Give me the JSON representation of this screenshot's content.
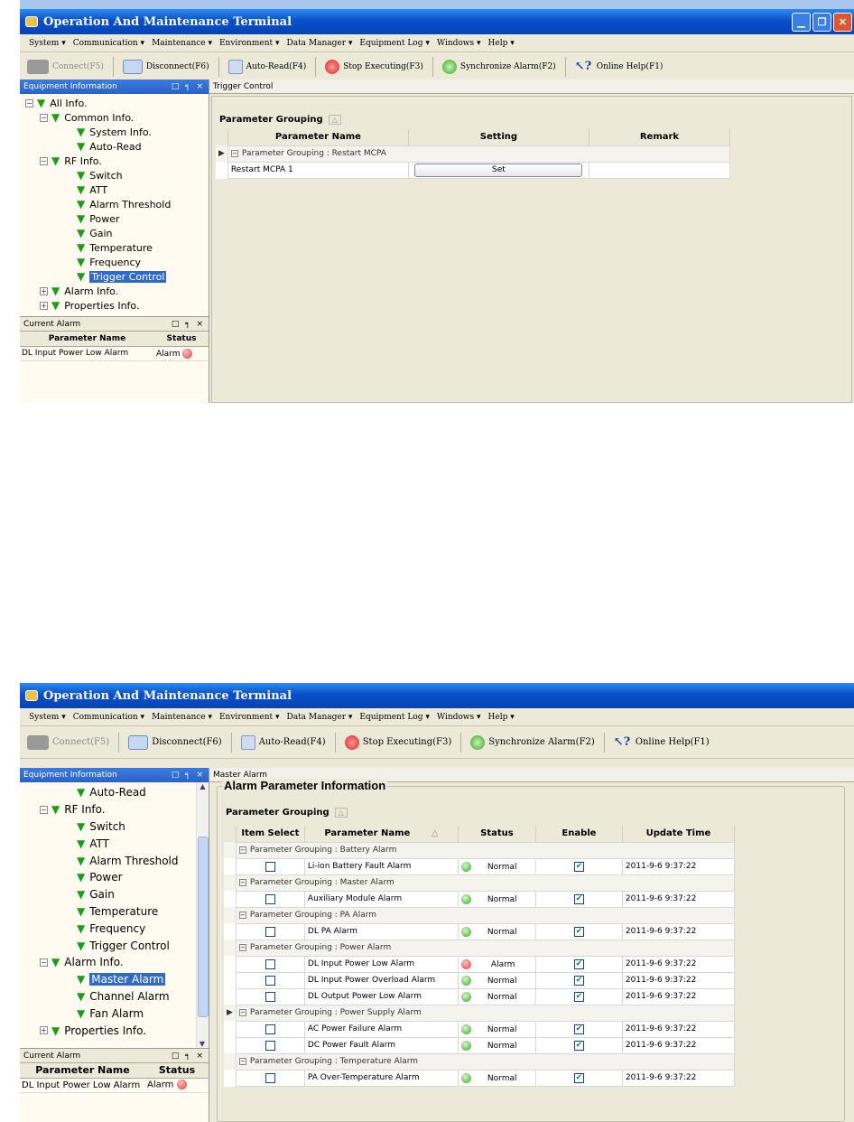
{
  "app_title": "Operation And Maintenance Terminal",
  "menu": [
    "System ▾",
    "Communication ▾",
    "Maintenance ▾",
    "Environment ▾",
    "Data Manager ▾",
    "Equipment Log ▾",
    "Windows ▾",
    "Help ▾"
  ],
  "toolbar": {
    "connect": "Connect(F5)",
    "disconnect": "Disconnect(F6)",
    "auto_read": "Auto-Read(F4)",
    "stop": "Stop Executing(F3)",
    "sync": "Synchronize Alarm(F2)",
    "help": "Online Help(F1)"
  },
  "panels": {
    "equipment": "Equipment Information",
    "current_alarm": "Current Alarm",
    "panel_controls": "□ ╕ ×"
  },
  "tree1": [
    {
      "label": "All Info.",
      "exp": "−"
    },
    {
      "label": "Common Info.",
      "exp": "−"
    },
    {
      "label": "System Info."
    },
    {
      "label": "Auto-Read"
    },
    {
      "label": "RF Info.",
      "exp": "−"
    },
    {
      "label": "Switch"
    },
    {
      "label": "ATT"
    },
    {
      "label": "Alarm Threshold"
    },
    {
      "label": "Power"
    },
    {
      "label": "Gain"
    },
    {
      "label": "Temperature"
    },
    {
      "label": "Frequency"
    },
    {
      "label": "Trigger Control"
    },
    {
      "label": "Alarm Info.",
      "exp": "+"
    },
    {
      "label": "Properties Info.",
      "exp": "+"
    }
  ],
  "tree2": [
    {
      "label": "Auto-Read"
    },
    {
      "label": "RF Info.",
      "exp": "−"
    },
    {
      "label": "Switch"
    },
    {
      "label": "ATT"
    },
    {
      "label": "Alarm Threshold"
    },
    {
      "label": "Power"
    },
    {
      "label": "Gain"
    },
    {
      "label": "Temperature"
    },
    {
      "label": "Frequency"
    },
    {
      "label": "Trigger Control"
    },
    {
      "label": "Alarm Info.",
      "exp": "−"
    },
    {
      "label": "Master Alarm"
    },
    {
      "label": "Channel Alarm"
    },
    {
      "label": "Fan Alarm"
    },
    {
      "label": "Properties Info.",
      "exp": "+"
    }
  ],
  "current_alarm": {
    "headers": {
      "name": "Parameter Name",
      "status": "Status"
    },
    "row": {
      "name": "DL Input Power Low Alarm",
      "status": "Alarm"
    }
  },
  "w1": {
    "tab": "Trigger Control",
    "group_label": "Parameter Grouping",
    "headers": {
      "name": "Parameter Name",
      "setting": "Setting",
      "remark": "Remark"
    },
    "group_row": "Parameter Grouping : Restart MCPA",
    "param": "Restart MCPA 1",
    "set": "Set"
  },
  "w2": {
    "tab": "Master Alarm",
    "fieldset": "Alarm Parameter Information",
    "group_label": "Parameter Grouping",
    "headers": {
      "select": "Item Select",
      "name": "Parameter Name",
      "status": "Status",
      "enable": "Enable",
      "time": "Update Time"
    },
    "groups": [
      {
        "title": "Parameter Grouping : Battery Alarm",
        "rows": [
          {
            "name": "Li-ion Battery Fault Alarm",
            "status": "Normal",
            "time": "2011-9-6 9:37:22"
          }
        ]
      },
      {
        "title": "Parameter Grouping : Master Alarm",
        "rows": [
          {
            "name": "Auxiliary Module Alarm",
            "status": "Normal",
            "time": "2011-9-6 9:37:22"
          }
        ]
      },
      {
        "title": "Parameter Grouping : PA Alarm",
        "rows": [
          {
            "name": "DL PA Alarm",
            "status": "Normal",
            "time": "2011-9-6 9:37:22"
          }
        ]
      },
      {
        "title": "Parameter Grouping : Power Alarm",
        "rows": [
          {
            "name": "DL Input Power Low Alarm",
            "status": "Alarm",
            "time": "2011-9-6 9:37:22"
          },
          {
            "name": "DL Input Power Overload Alarm",
            "status": "Normal",
            "time": "2011-9-6 9:37:22"
          },
          {
            "name": "DL Output Power Low Alarm",
            "status": "Normal",
            "time": "2011-9-6 9:37:22"
          }
        ]
      },
      {
        "title": "Parameter Grouping : Power Supply Alarm",
        "rows": [
          {
            "name": "AC Power Failure Alarm",
            "status": "Normal",
            "time": "2011-9-6 9:37:22"
          },
          {
            "name": "DC Power Fault Alarm",
            "status": "Normal",
            "time": "2011-9-6 9:37:22"
          }
        ]
      },
      {
        "title": "Parameter Grouping : Temperature Alarm",
        "rows": [
          {
            "name": "PA Over-Temperature Alarm",
            "status": "Normal",
            "time": "2011-9-6 9:37:22"
          }
        ]
      }
    ]
  }
}
